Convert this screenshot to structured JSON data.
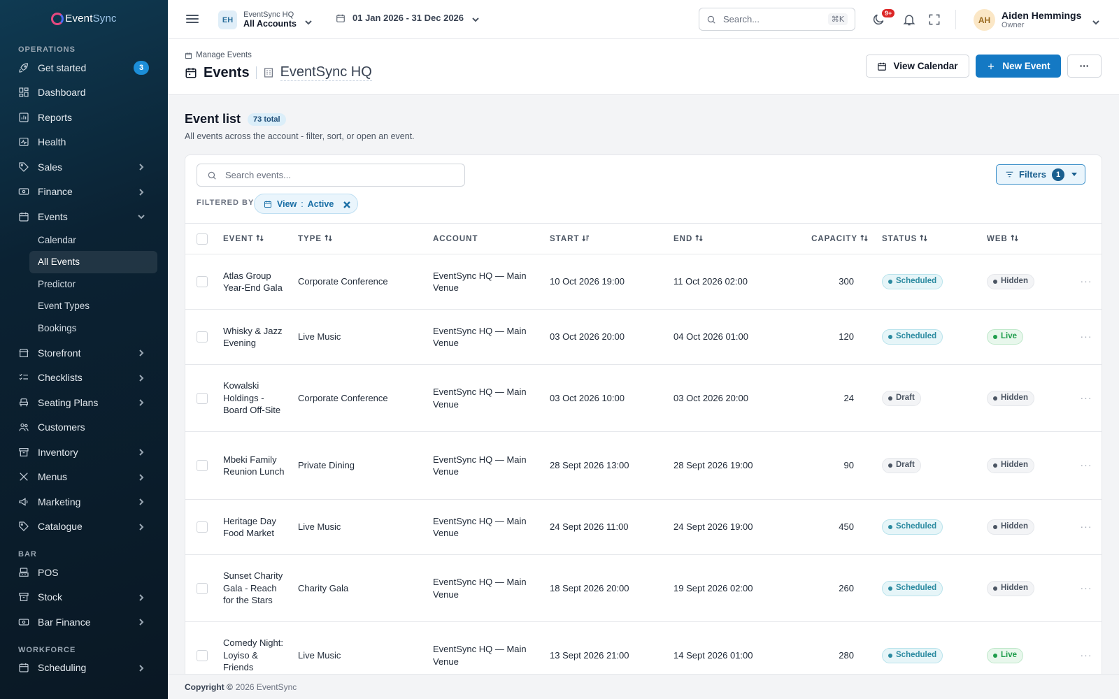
{
  "brand": {
    "name_a": "Event",
    "name_b": "Sync"
  },
  "sidebar": {
    "sections": [
      {
        "label": "OPERATIONS"
      },
      {
        "label": "BAR"
      },
      {
        "label": "WORKFORCE"
      }
    ],
    "items": [
      {
        "label": "Get started",
        "badge": "3"
      },
      {
        "label": "Dashboard"
      },
      {
        "label": "Reports"
      },
      {
        "label": "Health"
      },
      {
        "label": "Sales"
      },
      {
        "label": "Finance"
      },
      {
        "label": "Events"
      },
      {
        "label": "Storefront"
      },
      {
        "label": "Checklists"
      },
      {
        "label": "Seating Plans"
      },
      {
        "label": "Customers"
      },
      {
        "label": "Inventory"
      },
      {
        "label": "Menus"
      },
      {
        "label": "Marketing"
      },
      {
        "label": "Catalogue"
      },
      {
        "label": "POS"
      },
      {
        "label": "Stock"
      },
      {
        "label": "Bar Finance"
      },
      {
        "label": "Scheduling"
      }
    ],
    "events_sub": [
      {
        "label": "Calendar"
      },
      {
        "label": "All Events",
        "active": true
      },
      {
        "label": "Predictor"
      },
      {
        "label": "Event Types"
      },
      {
        "label": "Bookings"
      }
    ]
  },
  "topbar": {
    "account_initials": "EH",
    "account_org": "EventSync HQ",
    "account_scope": "All Accounts",
    "date_range": "01 Jan 2026 - 31 Dec 2026",
    "search_placeholder": "Search...",
    "search_shortcut": "⌘K",
    "notif_count": "9+",
    "user_initials": "AH",
    "user_name": "Aiden Hemmings",
    "user_role": "Owner"
  },
  "pagehead": {
    "breadcrumb": "Manage Events",
    "title": "Events",
    "account": "EventSync HQ",
    "view_calendar": "View Calendar",
    "new_event": "New Event",
    "more": "···"
  },
  "list": {
    "title": "Event list",
    "total": "73 total",
    "subtitle": "All events across the account - filter, sort, or open an event.",
    "search_placeholder": "Search events...",
    "filters_label": "Filters",
    "filters_count": "1",
    "filtered_by": "FILTERED BY",
    "chip_key": "View",
    "chip_sep": ":",
    "chip_value": "Active",
    "columns": {
      "event": "EVENT",
      "type": "TYPE",
      "account": "ACCOUNT",
      "start": "START",
      "end": "END",
      "capacity": "CAPACITY",
      "status": "STATUS",
      "web": "WEB"
    },
    "rows": [
      {
        "event": "Atlas Group Year-End Gala",
        "type": "Corporate Conference",
        "account": "EventSync HQ — Main Venue",
        "start": "10 Oct 2026 19:00",
        "end": "11 Oct 2026 02:00",
        "capacity": "300",
        "status": "Scheduled",
        "web": "Hidden"
      },
      {
        "event": "Whisky & Jazz Evening",
        "type": "Live Music",
        "account": "EventSync HQ — Main Venue",
        "start": "03 Oct 2026 20:00",
        "end": "04 Oct 2026 01:00",
        "capacity": "120",
        "status": "Scheduled",
        "web": "Live"
      },
      {
        "event": "Kowalski Holdings - Board Off-Site",
        "type": "Corporate Conference",
        "account": "EventSync HQ — Main Venue",
        "start": "03 Oct 2026 10:00",
        "end": "03 Oct 2026 20:00",
        "capacity": "24",
        "status": "Draft",
        "web": "Hidden"
      },
      {
        "event": "Mbeki Family Reunion Lunch",
        "type": "Private Dining",
        "account": "EventSync HQ — Main Venue",
        "start": "28 Sept 2026 13:00",
        "end": "28 Sept 2026 19:00",
        "capacity": "90",
        "status": "Draft",
        "web": "Hidden"
      },
      {
        "event": "Heritage Day Food Market",
        "type": "Live Music",
        "account": "EventSync HQ — Main Venue",
        "start": "24 Sept 2026 11:00",
        "end": "24 Sept 2026 19:00",
        "capacity": "450",
        "status": "Scheduled",
        "web": "Hidden"
      },
      {
        "event": "Sunset Charity Gala - Reach for the Stars",
        "type": "Charity Gala",
        "account": "EventSync HQ — Main Venue",
        "start": "18 Sept 2026 20:00",
        "end": "19 Sept 2026 02:00",
        "capacity": "260",
        "status": "Scheduled",
        "web": "Hidden"
      },
      {
        "event": "Comedy Night: Loyiso & Friends",
        "type": "Live Music",
        "account": "EventSync HQ — Main Venue",
        "start": "13 Sept 2026 21:00",
        "end": "14 Sept 2026 01:00",
        "capacity": "280",
        "status": "Scheduled",
        "web": "Live"
      }
    ]
  },
  "footer": {
    "copyright": "Copyright ©",
    "text": "2026 EventSync"
  },
  "colors": {
    "primary": "#1479c4",
    "sidebar_bg": "#0b2233",
    "scheduled": "#2b8aa0",
    "live": "#1f9d4c"
  }
}
